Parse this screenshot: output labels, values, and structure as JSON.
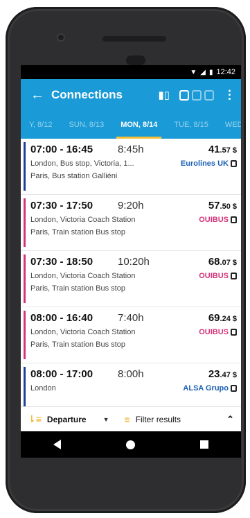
{
  "status": {
    "time": "12:42",
    "wifi_icon": "wifi-icon",
    "signal_icon": "signal-icon",
    "battery_icon": "battery-icon"
  },
  "appbar": {
    "title": "Connections",
    "back_icon": "back-arrow-icon"
  },
  "tabs": [
    {
      "label": "Y, 8/12"
    },
    {
      "label": "SUN, 8/13"
    },
    {
      "label": "MON, 8/14",
      "active": true
    },
    {
      "label": "TUE, 8/15"
    },
    {
      "label": "WED"
    }
  ],
  "rows": [
    {
      "time": "07:00 - 16:45",
      "duration": "8:45h",
      "price_main": "41",
      "price_cents": ".57 $",
      "from": "London, Bus stop, Victoria, 1...",
      "to": "Paris, Bus station Galliéni",
      "carrier": "Eurolines UK",
      "carrier_color": "#1a5fb4",
      "bar_color": "#1f3f99"
    },
    {
      "time": "07:30 - 17:50",
      "duration": "9:20h",
      "price_main": "57",
      "price_cents": ".50 $",
      "from": "London, Victoria Coach Station",
      "to": "Paris, Train station Bus stop",
      "carrier": "OUIBUS",
      "carrier_color": "#d6337a",
      "bar_color": "#d6337a"
    },
    {
      "time": "07:30 - 18:50",
      "duration": "10:20h",
      "price_main": "68",
      "price_cents": ".07 $",
      "from": "London, Victoria Coach Station",
      "to": "Paris, Train station Bus stop",
      "carrier": "OUIBUS",
      "carrier_color": "#d6337a",
      "bar_color": "#d6337a"
    },
    {
      "time": "08:00 - 16:40",
      "duration": "7:40h",
      "price_main": "69",
      "price_cents": ".24 $",
      "from": "London, Victoria Coach Station",
      "to": "Paris, Train station Bus stop",
      "carrier": "OUIBUS",
      "carrier_color": "#d6337a",
      "bar_color": "#d6337a"
    },
    {
      "time": "08:00 - 17:00",
      "duration": "8:00h",
      "price_main": "23",
      "price_cents": ".47 $",
      "from": "London",
      "to": "",
      "carrier": "ALSA Grupo",
      "carrier_color": "#1a5fb4",
      "bar_color": "#1f3f99"
    }
  ],
  "toolbar": {
    "sort_label": "Departure",
    "filter_label": "Filter results"
  },
  "colors": {
    "accent": "#1a9ad6",
    "highlight": "#f6c13d",
    "sort_icon": "#f0a500"
  }
}
